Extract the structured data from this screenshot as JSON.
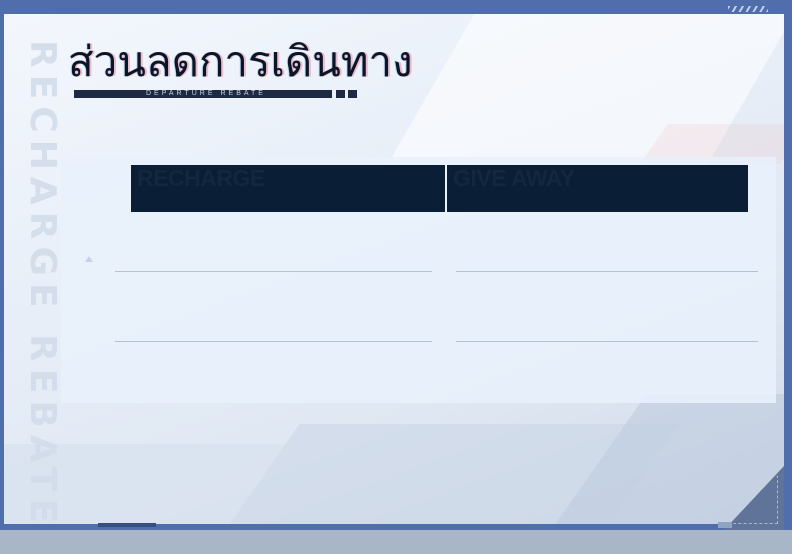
{
  "background": {
    "vertical_title": "RECHARGE REBATE"
  },
  "header": {
    "title": "ส่วนลดการเดินทาง",
    "subtitle": "DEPARTURE REBATE"
  },
  "table": {
    "columns": [
      {
        "label": "RECHARGE"
      },
      {
        "label": "GIVE AWAY"
      }
    ],
    "rows": []
  },
  "colors": {
    "frame": "#4f6eab",
    "header_bg": "#0a1f35",
    "title_text": "#0c1526"
  }
}
